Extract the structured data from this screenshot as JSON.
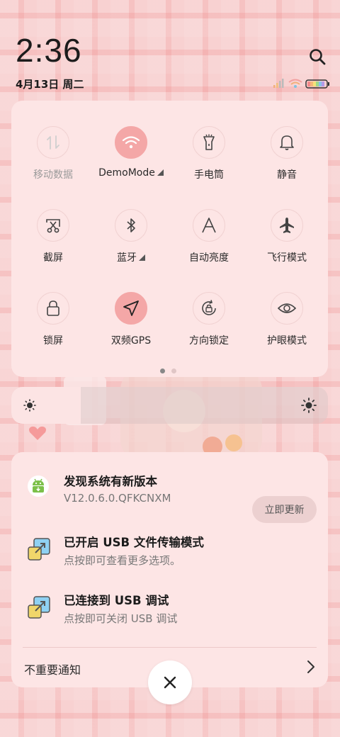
{
  "status_bar": {
    "time": "2:36",
    "date": "4月13日 周二",
    "icons": [
      "search-icon",
      "signal-icon",
      "wifi-icon",
      "battery-icon"
    ]
  },
  "quick_settings": {
    "tiles": [
      {
        "label": "移动数据",
        "icon": "mobile-data-icon",
        "active": false,
        "disabled": true
      },
      {
        "label": "DemoMode",
        "icon": "wifi-icon",
        "active": true,
        "expand": true
      },
      {
        "label": "手电筒",
        "icon": "flashlight-icon",
        "active": false
      },
      {
        "label": "静音",
        "icon": "bell-icon",
        "active": false
      },
      {
        "label": "截屏",
        "icon": "screenshot-icon",
        "active": false
      },
      {
        "label": "蓝牙",
        "icon": "bluetooth-icon",
        "active": false,
        "expand": true
      },
      {
        "label": "自动亮度",
        "icon": "auto-brightness-icon",
        "active": false
      },
      {
        "label": "飞行模式",
        "icon": "airplane-icon",
        "active": false
      },
      {
        "label": "锁屏",
        "icon": "lock-icon",
        "active": false
      },
      {
        "label": "双频GPS",
        "icon": "location-arrow-icon",
        "active": true
      },
      {
        "label": "方向锁定",
        "icon": "rotation-lock-icon",
        "active": false
      },
      {
        "label": "护眼模式",
        "icon": "eye-icon",
        "active": false
      }
    ],
    "page_indicator": {
      "pages": 2,
      "current": 1
    }
  },
  "brightness": {
    "level": 0.22
  },
  "notifications": {
    "items": [
      {
        "title": "发现系统有新版本",
        "subtitle": "V12.0.6.0.QFKCNXM",
        "icon": "android-update-icon",
        "action": "立即更新"
      },
      {
        "title": "已开启 USB 文件传输模式",
        "subtitle": "点按即可查看更多选项。",
        "icon": "usb-icon"
      },
      {
        "title": "已连接到 USB 调试",
        "subtitle": "点按即可关闭 USB 调试",
        "icon": "usb-icon"
      }
    ],
    "unimportant_label": "不重要通知"
  },
  "colors": {
    "accent": "#f4a7a7",
    "panel": "#fde5e5"
  }
}
